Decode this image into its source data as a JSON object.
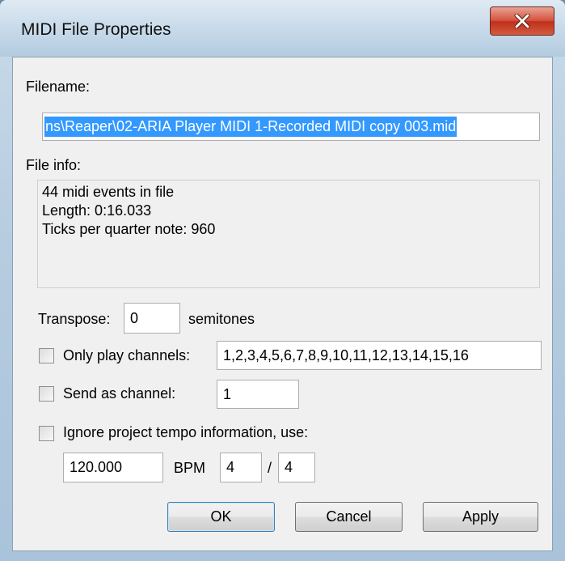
{
  "window": {
    "title": "MIDI File Properties",
    "close_icon": "close-icon"
  },
  "filename": {
    "label": "Filename:",
    "value": "ns\\Reaper\\02-ARIA Player MIDI 1-Recorded MIDI copy 003.mid"
  },
  "file_info": {
    "label": "File info:",
    "lines": [
      "44 midi events in file",
      "Length: 0:16.033",
      "Ticks per quarter note: 960"
    ]
  },
  "transpose": {
    "label": "Transpose:",
    "value": "0",
    "unit": "semitones"
  },
  "only_play_channels": {
    "label": "Only play channels:",
    "checked": false,
    "value": "1,2,3,4,5,6,7,8,9,10,11,12,13,14,15,16"
  },
  "send_as_channel": {
    "label": "Send as channel:",
    "checked": false,
    "value": "1"
  },
  "ignore_tempo": {
    "label": "Ignore project tempo information, use:",
    "checked": false,
    "bpm_value": "120.000",
    "bpm_label": "BPM",
    "numerator": "4",
    "slash": "/",
    "denominator": "4"
  },
  "buttons": {
    "ok": "OK",
    "cancel": "Cancel",
    "apply": "Apply"
  },
  "colors": {
    "selection": "#3399ff",
    "close_button": "#c94a34"
  }
}
